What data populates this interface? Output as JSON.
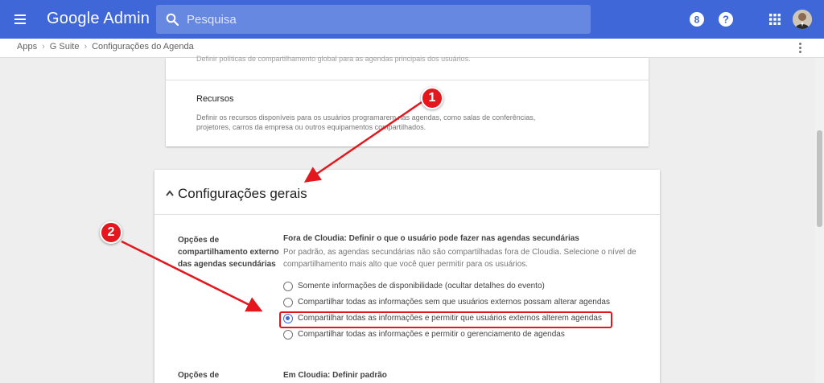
{
  "header": {
    "app_title": "Google Admin",
    "search_placeholder": "Pesquisa",
    "icons": [
      "menu-icon",
      "search-icon",
      "support-number-icon",
      "help-icon",
      "apps-grid-icon"
    ],
    "support_badge": "8",
    "help_glyph": "?",
    "colors": {
      "bar": "#3f67d8",
      "search": "#6788e0"
    }
  },
  "breadcrumb": [
    "Apps",
    "G Suite",
    "Configurações do Agenda"
  ],
  "top_card": {
    "cut_text": "Definir políticas de compartilhamento global para as agendas principais dos usuários.",
    "resources_title": "Recursos",
    "resources_desc": "Definir os recursos disponíveis para os usuários programarem nas agendas, como salas de conferências, projetores, carros da empresa ou outros equipamentos compartilhados."
  },
  "general": {
    "title": "Configurações gerais",
    "option_label": "Opções de compartilhamento externo das agendas secundárias",
    "option_heading": "Fora de Cloudia: Definir o que o usuário pode fazer nas agendas secundárias",
    "option_desc": "Por padrão, as agendas secundárias não são compartilhadas fora de Cloudia. Selecione o nível de compartilhamento mais alto que você quer permitir para os usuários.",
    "choices": [
      {
        "label": "Somente informações de disponibilidade (ocultar detalhes do evento)",
        "selected": false
      },
      {
        "label": "Compartilhar todas as informações sem que usuários externos possam alterar agendas",
        "selected": false
      },
      {
        "label": "Compartilhar todas as informações e permitir que usuários externos alterem agendas",
        "selected": true
      },
      {
        "label": "Compartilhar todas as informações e permitir o gerenciamento de agendas",
        "selected": false
      }
    ],
    "next_label": "Opções de",
    "next_heading": "Em Cloudia: Definir padrão"
  },
  "annotations": {
    "badge_1": "1",
    "badge_2": "2",
    "color": "#e3181f"
  }
}
